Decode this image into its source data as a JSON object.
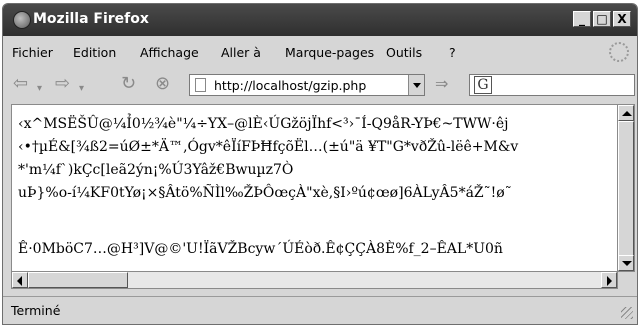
{
  "window": {
    "title": "Mozilla Firefox",
    "buttons": {
      "minimize": "_",
      "maximize": "□",
      "close": "X"
    }
  },
  "menu": [
    {
      "label": "Fichier"
    },
    {
      "label": "Edition"
    },
    {
      "label": "Affichage"
    },
    {
      "label": "Aller à"
    },
    {
      "label": "Marque-pages"
    },
    {
      "label": "Outils"
    },
    {
      "label": "?"
    }
  ],
  "nav": {
    "back_icon": "⇦",
    "forward_icon": "⇨",
    "reload_icon": "↻",
    "stop_icon": "⊗",
    "url": "http://localhost/gzip.php",
    "go_icon": "⇒",
    "search_engine_icon": "G"
  },
  "content": {
    "lines": [
      "‹x^MSËŠÛ@¼Ỉ0½¾è\"¼÷YX–@lÈ‹ÚGžöjÏhf<³›¯Í-Q9åR-YÞ€~TWW·êj",
      "‹•†µÉ&[¾ß2=úØ±*Ä™‚Ógv*êÏíFÞĦfçõËl…(±ú\"ä ¥T\"G*vðŽû-lëê+M&v",
      "*'m¼f`)kÇc[leã2ýn¡%Ú3Yâž€Bwuµz7Ò",
      "uÞ}%o-í¼KF0tYø¡×§Âtö%ÑÌl‰ŽÞÔœçÀ\"xè,§I›ºú¢œø]6ÀLyÂ5*áŽ˜!ø˜",
      "",
      "Ê·0MböC7…@H³]V@©'U!ÏãVŽBcyw´ÚÉòð.Ê¢ÇÇÀ8È%f_2–ÊAL*U0ñ"
    ]
  },
  "status": {
    "text": "Terminé"
  }
}
